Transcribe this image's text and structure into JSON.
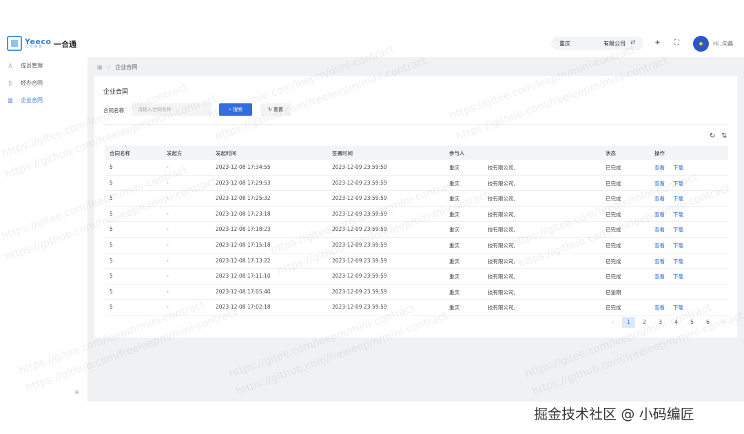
{
  "header": {
    "logo_name": "Yeeco",
    "logo_sub": "云 合 易 签",
    "app_title": "一合通",
    "company_city": "重庆",
    "company_name": "有限公司",
    "greeting": "Hi ,向晨"
  },
  "sidebar": {
    "items": [
      {
        "label": "成员管理",
        "icon": "users-icon",
        "active": false
      },
      {
        "label": "经办合同",
        "icon": "document-icon",
        "active": false
      },
      {
        "label": "企业合同",
        "icon": "book-icon",
        "active": true
      }
    ]
  },
  "breadcrumb": {
    "current": "企业合同"
  },
  "card": {
    "title": "企业合同",
    "filter_label": "合同名称",
    "filter_placeholder": "请输入合同名称",
    "search_label": "搜索",
    "reset_label": "重置"
  },
  "table": {
    "headers": [
      "合同名称",
      "发起方",
      "发起时间",
      "签署时间",
      "参与人",
      "",
      "状态",
      "操作",
      ""
    ],
    "rows": [
      {
        "name": "5",
        "initiator": "-",
        "start": "2023-12-08 17:34:55",
        "sign": "2023-12-09 23:59:59",
        "p1": "重庆",
        "p2": "技有限公司,",
        "status": "已完成",
        "view": "查看",
        "download": "下载"
      },
      {
        "name": "5",
        "initiator": "-",
        "start": "2023-12-08 17:29:53",
        "sign": "2023-12-09 23:59:59",
        "p1": "重庆",
        "p2": "技有限公司,",
        "status": "已完成",
        "view": "查看",
        "download": "下载"
      },
      {
        "name": "5",
        "initiator": "-",
        "start": "2023-12-08 17:25:32",
        "sign": "2023-12-09 23:59:59",
        "p1": "重庆",
        "p2": "技有限公司,",
        "status": "已完成",
        "view": "查看",
        "download": "下载"
      },
      {
        "name": "5",
        "initiator": "-",
        "start": "2023-12-08 17:23:18",
        "sign": "2023-12-09 23:59:59",
        "p1": "重庆",
        "p2": "技有限公司,",
        "status": "已完成",
        "view": "查看",
        "download": "下载"
      },
      {
        "name": "5",
        "initiator": "-",
        "start": "2023-12-08 17:18:23",
        "sign": "2023-12-09 23:59:59",
        "p1": "重庆",
        "p2": "技有限公司,",
        "status": "已完成",
        "view": "查看",
        "download": "下载"
      },
      {
        "name": "5",
        "initiator": "-",
        "start": "2023-12-08 17:15:18",
        "sign": "2023-12-09 23:59:59",
        "p1": "重庆",
        "p2": "技有限公司,",
        "status": "已完成",
        "view": "查看",
        "download": "下载"
      },
      {
        "name": "5",
        "initiator": "-",
        "start": "2023-12-08 17:13:22",
        "sign": "2023-12-09 23:59:59",
        "p1": "重庆",
        "p2": "技有限公司,",
        "status": "已完成",
        "view": "查看",
        "download": "下载"
      },
      {
        "name": "5",
        "initiator": "-",
        "start": "2023-12-08 17:11:10",
        "sign": "2023-12-09 23:59:59",
        "p1": "重庆",
        "p2": "技有限公司,",
        "status": "已完成",
        "view": "查看",
        "download": "下载"
      },
      {
        "name": "5",
        "initiator": "-",
        "start": "2023-12-08 17:05:40",
        "sign": "2023-12-09 23:59:59",
        "p1": "重庆",
        "p2": "技有限公司,",
        "status": "已逾期",
        "view": "",
        "download": ""
      },
      {
        "name": "5",
        "initiator": "-",
        "start": "2023-12-08 17:02:18",
        "sign": "2023-12-09 23:59:59",
        "p1": "重庆",
        "p2": "技有限公司,",
        "status": "已完成",
        "view": "查看",
        "download": "下载"
      }
    ]
  },
  "pagination": {
    "prev": "‹",
    "pages": [
      "1",
      "2",
      "3",
      "4",
      "5",
      "6"
    ],
    "next": "›"
  },
  "watermarks": {
    "gitee": "https://gitee.com/leepm/mini-contract",
    "github": "https://github.com/freeleepm/mini-contract"
  },
  "credit": "掘金技术社区 @ 小码编匠",
  "colors": {
    "accent": "#2f6fe0",
    "page_bg": "#f0f1f3"
  }
}
